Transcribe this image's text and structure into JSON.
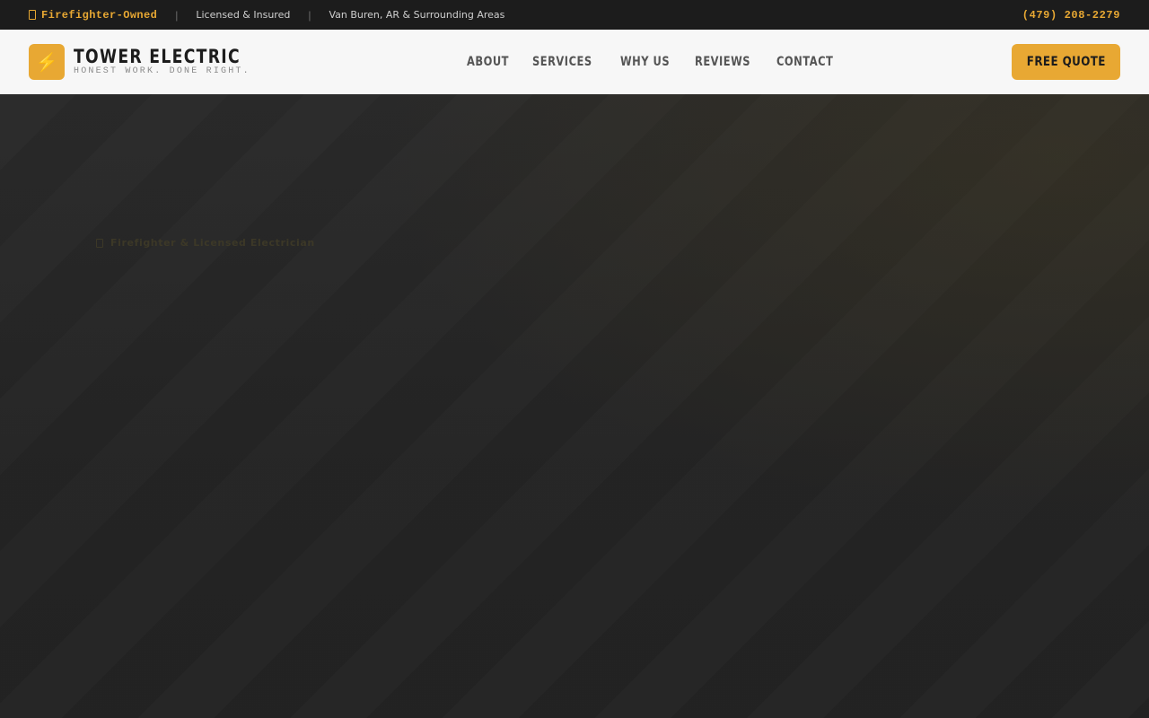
{
  "topbar": {
    "badge": "Firefighter-Owned",
    "badge_icon": "badge-icon",
    "licensed": "Licensed & Insured",
    "area": "Van Buren, AR & Surrounding Areas",
    "phone": "(479) 208-2279",
    "separator": "|"
  },
  "header": {
    "logo_icon": "lightning-bolt-icon",
    "logo_symbol": "⚡",
    "title": "TOWER ELECTRIC",
    "tagline": "HONEST WORK. DONE RIGHT.",
    "nav": [
      "ABOUT",
      "SERVICES",
      "WHY US",
      "REVIEWS",
      "CONTACT"
    ],
    "cta": "FREE QUOTE"
  },
  "hero": {
    "eyebrow": "Firefighter & Licensed Electrician",
    "eyebrow_icon": "badge-icon"
  },
  "colors": {
    "accent": "#e8a833",
    "topbar_bg": "#1c1c1c",
    "header_bg": "#f7f7f7",
    "hero_bg": "#242424"
  }
}
